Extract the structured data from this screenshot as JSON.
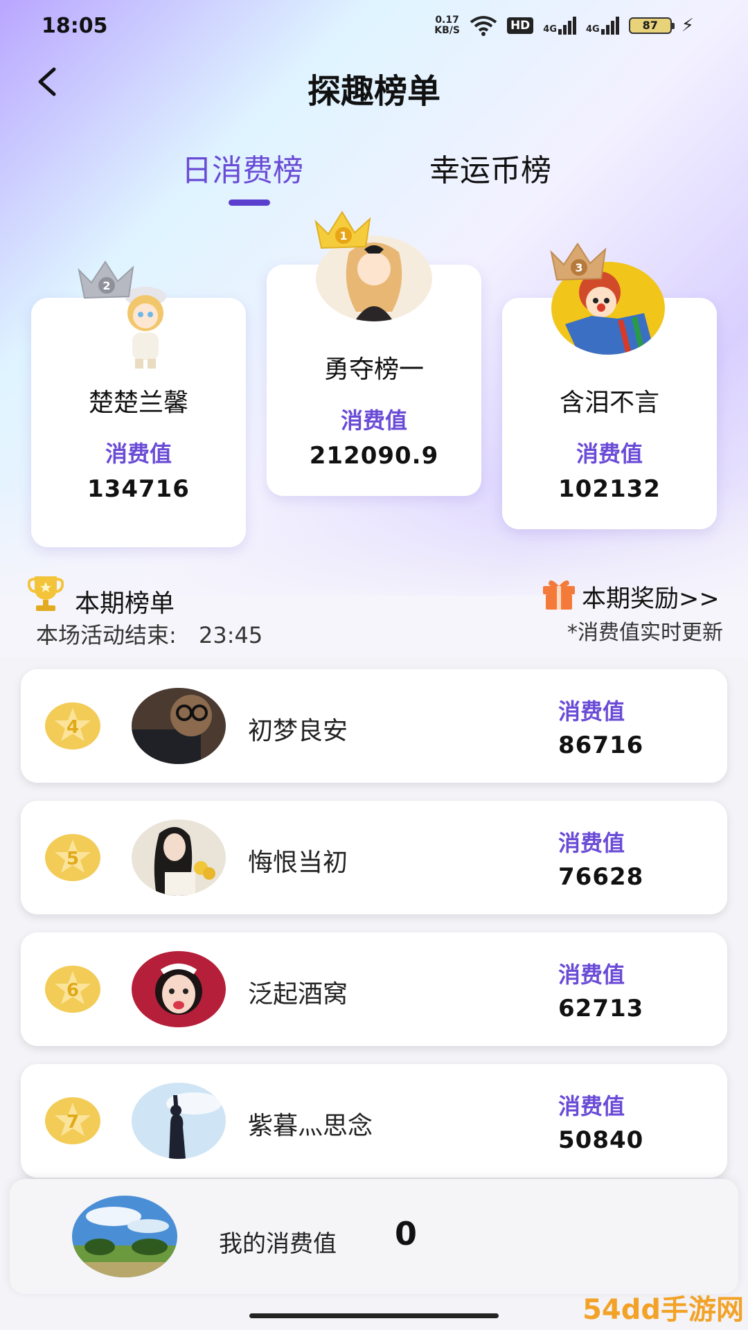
{
  "status_bar": {
    "time": "18:05",
    "net_speed_value": "0.17",
    "net_speed_unit": "KB/S",
    "hd_label": "HD",
    "signal_label_1": "4G",
    "signal_label_2": "4G",
    "battery": "87",
    "icons": [
      "wifi-icon",
      "signal-icon",
      "battery-icon",
      "bolt-icon"
    ]
  },
  "header": {
    "title": "探趣榜单",
    "back_icon": "chevron-left-icon"
  },
  "tabs": [
    {
      "label": "日消费榜",
      "active": true
    },
    {
      "label": "幸运币榜",
      "active": false
    }
  ],
  "podium": [
    {
      "rank": 2,
      "name": "楚楚兰馨",
      "label": "消费值",
      "value": "134716"
    },
    {
      "rank": 1,
      "name": "勇夺榜一",
      "label": "消费值",
      "value": "212090.9"
    },
    {
      "rank": 3,
      "name": "含泪不言",
      "label": "消费值",
      "value": "102132"
    }
  ],
  "period": {
    "title": "本期榜单",
    "countdown_label": "本场活动结束:",
    "countdown_time": "23:45",
    "rewards_link": "本期奖励>>",
    "update_note": "*消费值实时更新"
  },
  "ranking": [
    {
      "rank": "4",
      "name": "初梦良安",
      "label": "消费值",
      "value": "86716"
    },
    {
      "rank": "5",
      "name": "悔恨当初",
      "label": "消费值",
      "value": "76628"
    },
    {
      "rank": "6",
      "name": "泛起酒窝",
      "label": "消费值",
      "value": "62713"
    },
    {
      "rank": "7",
      "name": "紫暮灬思念",
      "label": "消费值",
      "value": "50840"
    }
  ],
  "my_stats": {
    "label": "我的消费值",
    "value": "0"
  },
  "watermark": "54dd手游网",
  "colors": {
    "accent": "#6a4bd6",
    "underline": "#5a3ecd",
    "gold": "#f0c94a",
    "gift": "#f47a3a"
  }
}
